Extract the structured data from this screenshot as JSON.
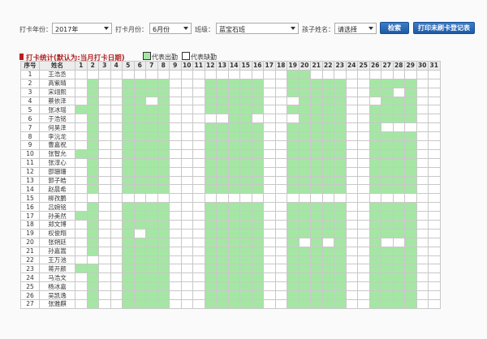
{
  "filters": {
    "year_label": "打卡年份：",
    "year_value": "2017年",
    "month_label": "打卡月份：",
    "month_value": "6月份",
    "class_label": "班级：",
    "class_value": "蓝宝石班",
    "child_label": "孩子姓名：",
    "child_value": "请选择",
    "search_button": "检索",
    "print_button": "打印未刷卡登记表"
  },
  "stats": {
    "title": "打卡统计(默认为:当月打卡日期)",
    "legend_present": "代表出勤",
    "legend_absent": "代表缺勤"
  },
  "colors": {
    "present": "#a5e6a5",
    "absent": "#ffffff",
    "accent": "#b22222",
    "button": "#2a6bb8"
  },
  "table": {
    "seq_header": "序号",
    "name_header": "姓名",
    "days": [
      "1",
      "2",
      "3",
      "4",
      "5",
      "6",
      "7",
      "8",
      "9",
      "10",
      "11",
      "12",
      "13",
      "14",
      "15",
      "16",
      "17",
      "18",
      "19",
      "20",
      "21",
      "22",
      "23",
      "24",
      "25",
      "26",
      "27",
      "28",
      "29",
      "30",
      "31"
    ],
    "rows": [
      {
        "seq": "1",
        "name": "王浩丞",
        "att": "0000000000000000001100000000000"
      },
      {
        "seq": "2",
        "name": "高紫晴",
        "att": "0100111100011111001111100111100"
      },
      {
        "seq": "3",
        "name": "宋翊熙",
        "att": "0100111100011111001111100110100"
      },
      {
        "seq": "4",
        "name": "蔡依泽",
        "att": "0100110100011111000111100011100"
      },
      {
        "seq": "5",
        "name": "张冰瑶",
        "att": "1100111100011111001111100111100"
      },
      {
        "seq": "6",
        "name": "于浩铭",
        "att": "0100111100000110000111100111100"
      },
      {
        "seq": "7",
        "name": "何昊泽",
        "att": "0100111100011111001111100100000"
      },
      {
        "seq": "8",
        "name": "李沅龙",
        "att": "0100111100011111001111100111100"
      },
      {
        "seq": "9",
        "name": "曹嘉祝",
        "att": "0100111100011111001111100111100"
      },
      {
        "seq": "10",
        "name": "张智允",
        "att": "1100111100011111001111100111100"
      },
      {
        "seq": "11",
        "name": "张淳心",
        "att": "0100111100011111001111100111100"
      },
      {
        "seq": "12",
        "name": "邵珊珊",
        "att": "0100111100011111001111100111100"
      },
      {
        "seq": "13",
        "name": "郭子皓",
        "att": "0100111100011111001111100111100"
      },
      {
        "seq": "14",
        "name": "赵晨希",
        "att": "0100111100011111001111100111100"
      },
      {
        "seq": "15",
        "name": "柳孜鹏",
        "att": "0000000000000000000000000000000"
      },
      {
        "seq": "16",
        "name": "吕婉铭",
        "att": "0100111100011111001111100111100"
      },
      {
        "seq": "17",
        "name": "孙美然",
        "att": "1100111100011111001111100111100"
      },
      {
        "seq": "18",
        "name": "郑文博",
        "att": "0100111100011111001111100111100"
      },
      {
        "seq": "19",
        "name": "权俊翔",
        "att": "0100101100011111001111100111100"
      },
      {
        "seq": "20",
        "name": "张朔廷",
        "att": "0100111100011111001010100100100"
      },
      {
        "seq": "21",
        "name": "孙嘉嵩",
        "att": "0100111100011111001111100111100"
      },
      {
        "seq": "22",
        "name": "王万池",
        "att": "0000111100011111001111100111100"
      },
      {
        "seq": "23",
        "name": "蒋开颜",
        "att": "1100111100011111001111100111100"
      },
      {
        "seq": "24",
        "name": "马浩文",
        "att": "0100111100011111001111100111100"
      },
      {
        "seq": "25",
        "name": "杨冰嘉",
        "att": "0100111100011111001111100111100"
      },
      {
        "seq": "26",
        "name": "吴凯逸",
        "att": "0100111100011111001111100111100"
      },
      {
        "seq": "27",
        "name": "张雅麒",
        "att": "0100111100011111001111100111100"
      }
    ]
  }
}
